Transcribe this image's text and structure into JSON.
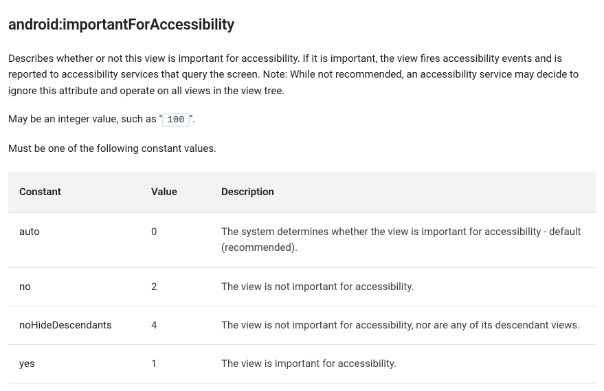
{
  "title": "android:importantForAccessibility",
  "description": "Describes whether or not this view is important for accessibility. If it is important, the view fires accessibility events and is reported to accessibility services that query the screen. Note: While not recommended, an accessibility service may decide to ignore this attribute and operate on all views in the view tree.",
  "int_sentence_prefix": "May be an integer value, such as \"",
  "int_example": "100",
  "int_sentence_suffix": "\".",
  "must_be_sentence": "Must be one of the following constant values.",
  "table": {
    "headers": {
      "constant": "Constant",
      "value": "Value",
      "description": "Description"
    },
    "rows": [
      {
        "constant": "auto",
        "value": "0",
        "description": "The system determines whether the view is important for accessibility - default (recommended)."
      },
      {
        "constant": "no",
        "value": "2",
        "description": "The view is not important for accessibility."
      },
      {
        "constant": "noHideDescendants",
        "value": "4",
        "description": "The view is not important for accessibility, nor are any of its descendant views."
      },
      {
        "constant": "yes",
        "value": "1",
        "description": "The view is important for accessibility."
      }
    ]
  }
}
